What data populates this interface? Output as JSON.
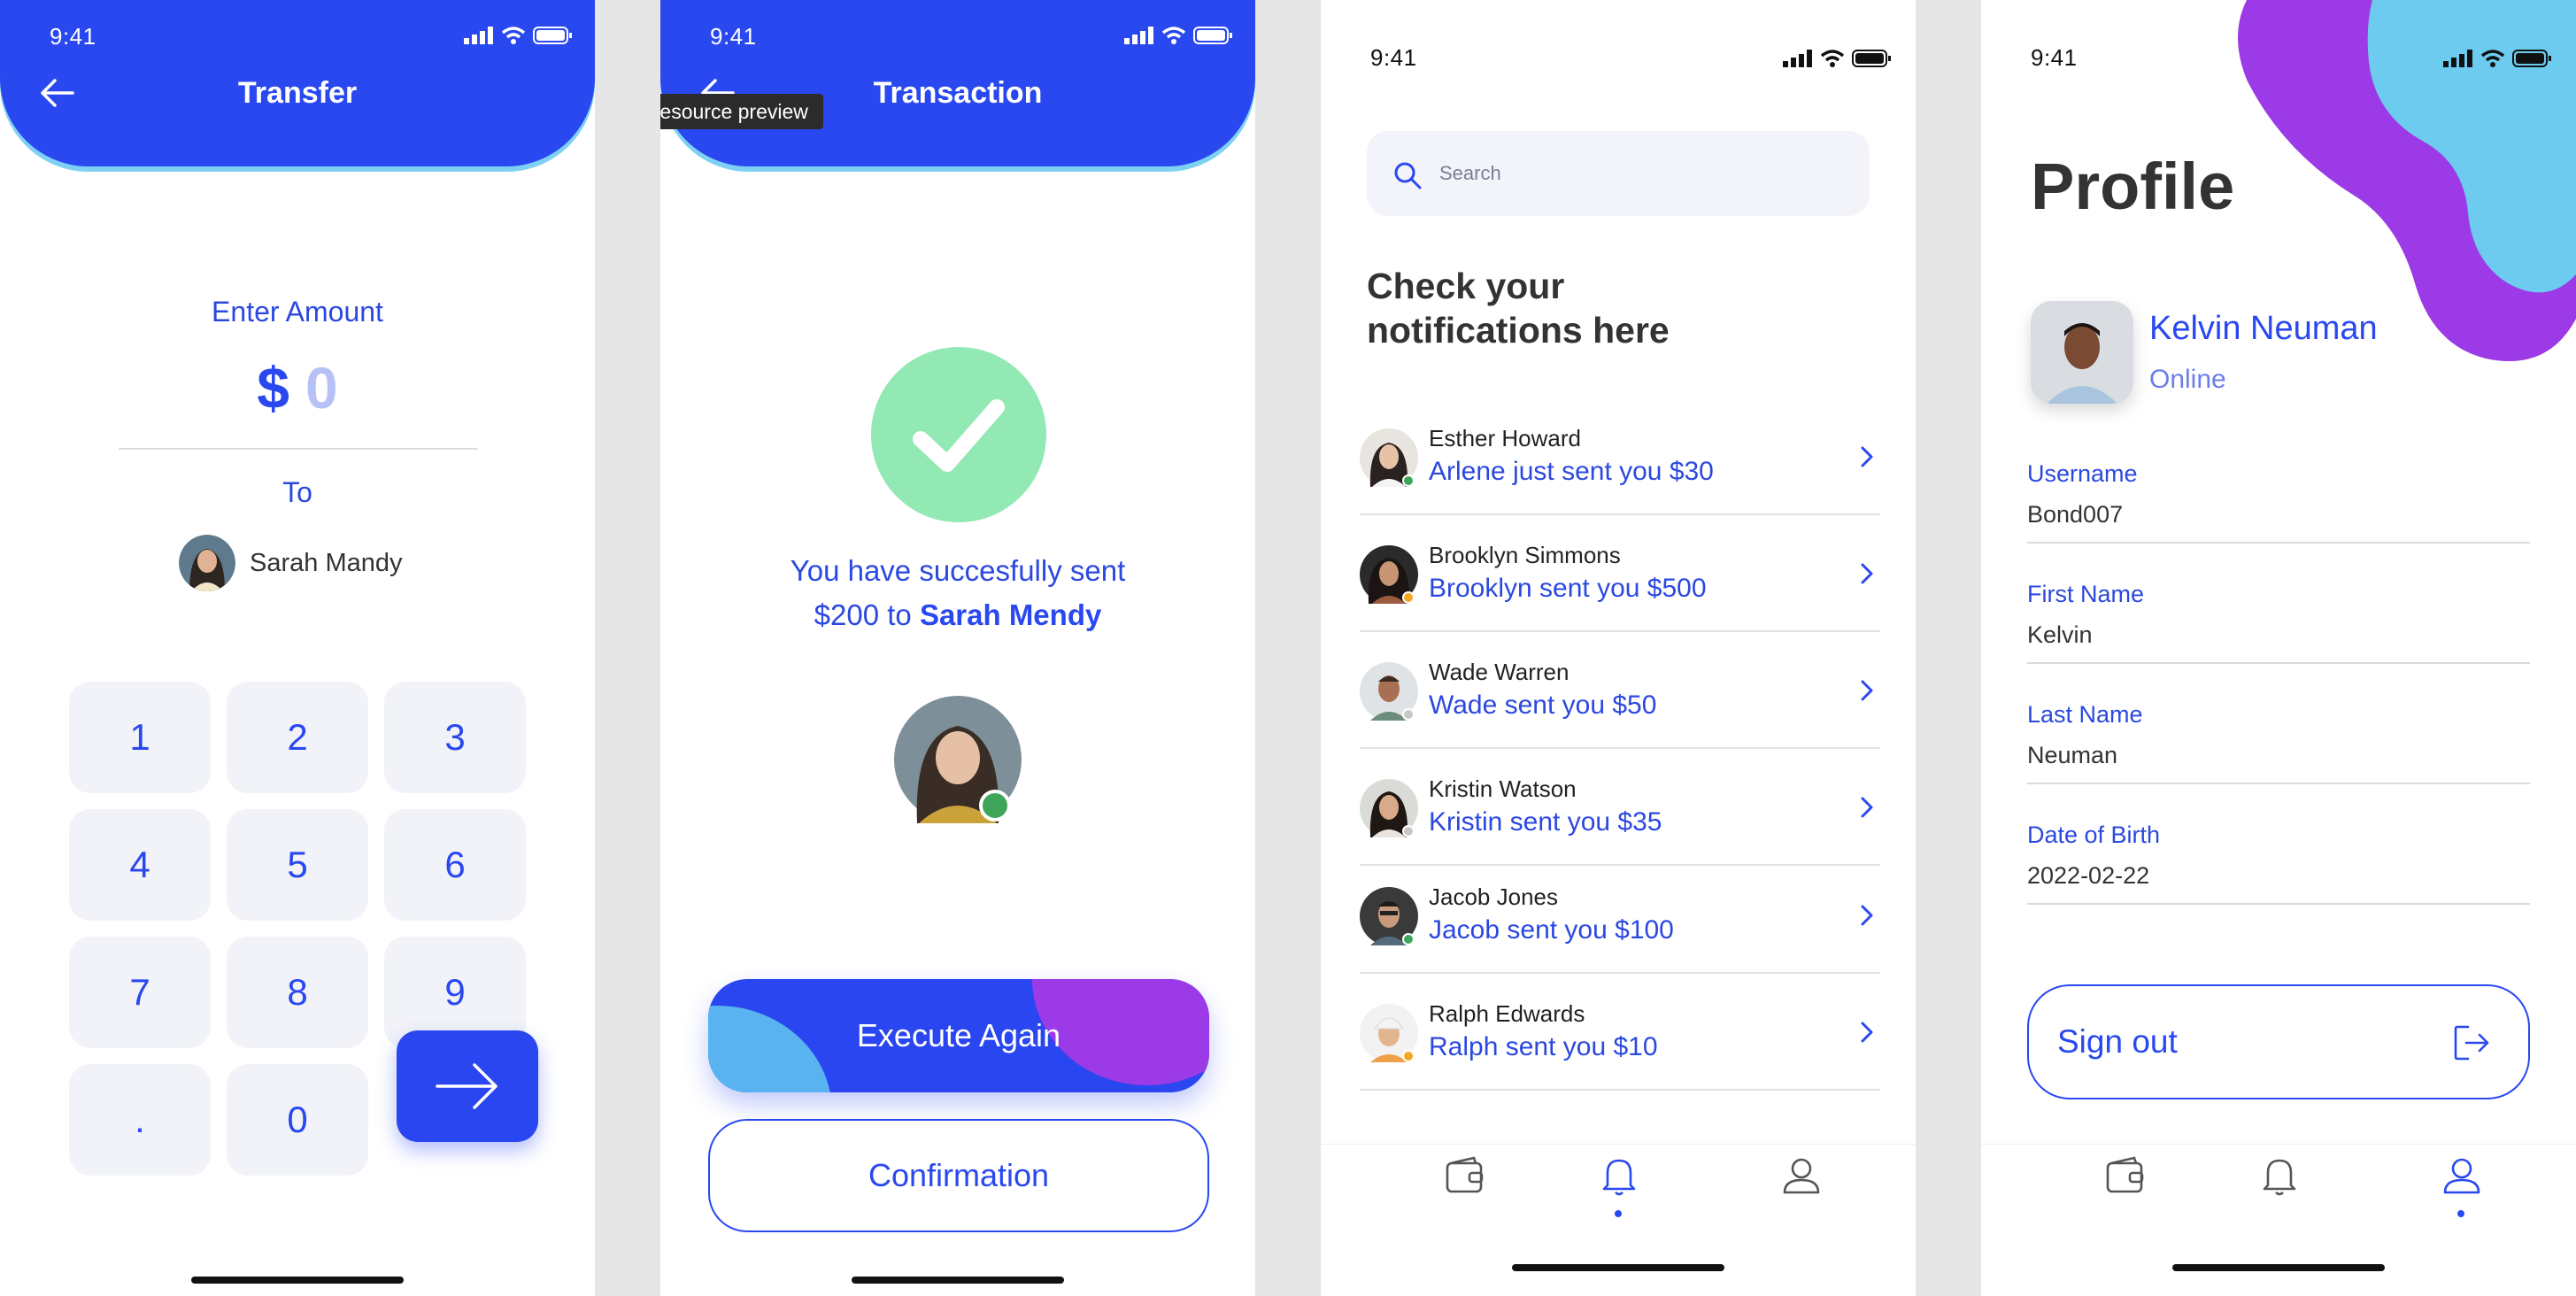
{
  "status": {
    "time": "9:41"
  },
  "tooltip": "Community resource preview",
  "transfer": {
    "title": "Transfer",
    "enter_amount_label": "Enter Amount",
    "currency": "$",
    "amount": "0",
    "to_label": "To",
    "recipient": "Sarah Mandy",
    "keys": [
      "1",
      "2",
      "3",
      "4",
      "5",
      "6",
      "7",
      "8",
      "9",
      ".",
      "0"
    ]
  },
  "transaction": {
    "title": "Transaction",
    "message_line1": "You have succesfully sent",
    "message_amount": "$200 to ",
    "message_recipient": "Sarah Mendy",
    "execute_again": "Execute Again",
    "confirmation": "Confirmation"
  },
  "notifications": {
    "search_placeholder": "Search",
    "title_line1": "Check your",
    "title_line2": "notifications here",
    "items": [
      {
        "name": "Esther Howard",
        "message": "Arlene just sent you $30",
        "status_color": "#3fa55b"
      },
      {
        "name": "Brooklyn Simmons",
        "message": "Brooklyn sent you $500",
        "status_color": "#f5a623"
      },
      {
        "name": "Wade Warren",
        "message": "Wade sent you $50",
        "status_color": "#c8c8c8"
      },
      {
        "name": "Kristin Watson",
        "message": "Kristin sent you $35",
        "status_color": "#c8c8c8"
      },
      {
        "name": "Jacob Jones",
        "message": "Jacob sent you $100",
        "status_color": "#3fa55b"
      },
      {
        "name": "Ralph Edwards",
        "message": "Ralph sent you $10",
        "status_color": "#f5a623"
      }
    ]
  },
  "profile": {
    "title": "Profile",
    "name": "Kelvin Neuman",
    "status": "Online",
    "fields": [
      {
        "label": "Username",
        "value": "Bond007"
      },
      {
        "label": "First Name",
        "value": "Kelvin"
      },
      {
        "label": "Last Name",
        "value": "Neuman"
      },
      {
        "label": "Date of Birth",
        "value": "2022-02-22"
      }
    ],
    "sign_out": "Sign out"
  },
  "tabs": [
    "wallet-icon",
    "bell-icon",
    "user-icon"
  ],
  "colors": {
    "primary": "#2948f0",
    "success": "#92e9b4",
    "purple": "#9b3ae6",
    "cyan": "#6ccbef"
  }
}
